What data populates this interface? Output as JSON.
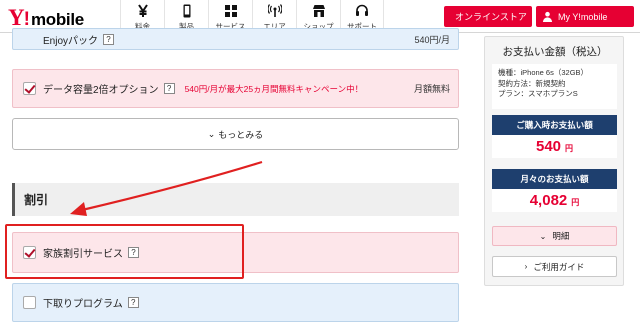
{
  "header": {
    "logo": {
      "y": "Y",
      "bang": "!",
      "word": "mobile"
    },
    "nav": [
      {
        "label": "料金",
        "icon": "yen-icon"
      },
      {
        "label": "製品",
        "icon": "phone-icon"
      },
      {
        "label": "サービス",
        "icon": "grid-icon"
      },
      {
        "label": "エリア",
        "icon": "antenna-icon"
      },
      {
        "label": "ショップ",
        "icon": "shop-icon"
      },
      {
        "label": "サポート",
        "icon": "headset-icon"
      }
    ],
    "store_button": "オンラインストア",
    "my_button": "My Y!mobile"
  },
  "options": {
    "enjoy_pack": {
      "label": "Enjoyパック",
      "help": "?",
      "price": "540円/月"
    },
    "data_double": {
      "label": "データ容量2倍オプション",
      "help": "?",
      "promo": "540円/月が最大25ヵ月間無料キャンペーン中！",
      "price": "月額無料",
      "checked": true
    },
    "more_button": "もっとみる"
  },
  "discount": {
    "section_title": "割引",
    "family": {
      "label": "家族割引サービス",
      "help": "?",
      "checked": true
    },
    "tradein": {
      "label": "下取りプログラム",
      "help": "?",
      "checked": false
    }
  },
  "sidebar": {
    "title": "お支払い金額（税込）",
    "spec": {
      "model": "機種：iPhone 6s（32GB）",
      "contract": "契約方法：新規契約",
      "plan": "プラン：スマホプランS"
    },
    "purchase_header": "ご購入時お支払い額",
    "purchase_amount": "540",
    "monthly_header": "月々のお支払い額",
    "monthly_amount": "4,082",
    "currency": "円",
    "details_button": "明細",
    "guide_button": "ご利用ガイド"
  },
  "colors": {
    "brand_red": "#e60033",
    "navy": "#1e3f6e",
    "annotation_red": "#e02020"
  }
}
